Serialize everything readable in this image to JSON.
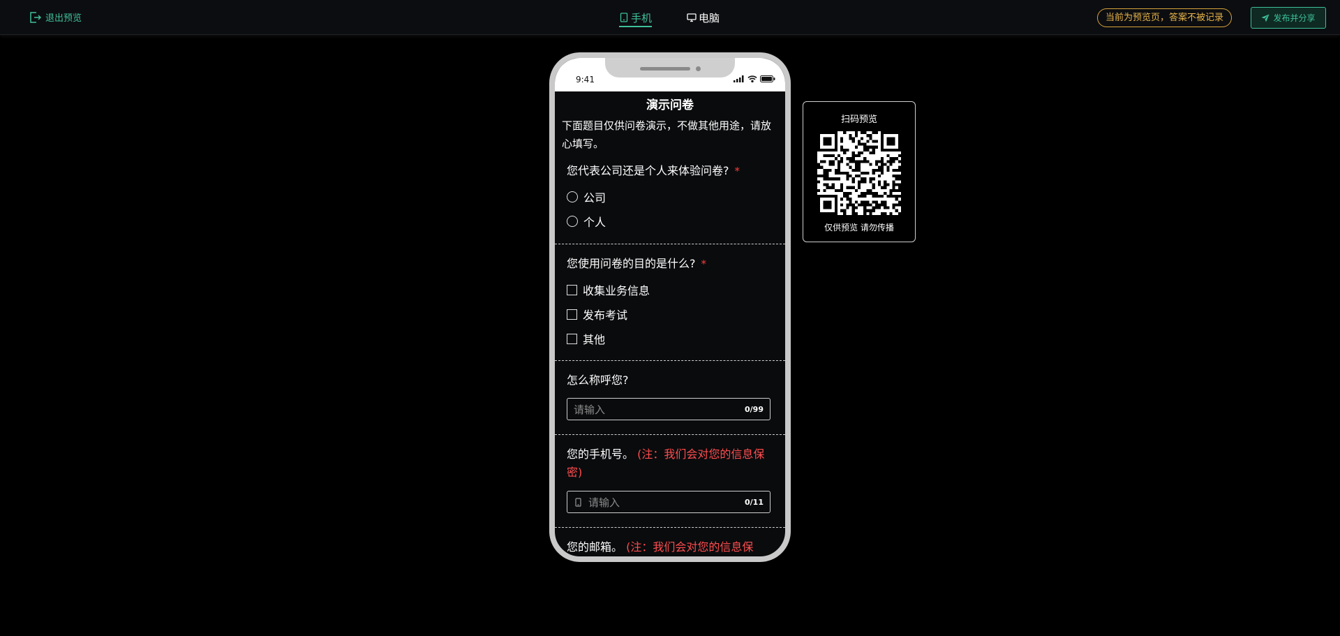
{
  "header": {
    "exit_label": "退出预览",
    "tabs": [
      {
        "label": "手机",
        "active": true,
        "icon": "phone-icon"
      },
      {
        "label": "电脑",
        "active": false,
        "icon": "monitor-icon"
      }
    ],
    "notice": "当前为预览页，答案不被记录",
    "publish_label": "发布并分享"
  },
  "colors": {
    "accent": "#3ec09a",
    "notice": "#e6b34a",
    "required": "#ff3b3b"
  },
  "phone": {
    "time": "9:41",
    "survey": {
      "title": "演示问卷",
      "description": "下面题目仅供问卷演示，不做其他用途，请放心填写。",
      "questions": [
        {
          "title": "您代表公司还是个人来体验问卷?",
          "required": "*",
          "type": "radio",
          "options": [
            "公司",
            "个人"
          ]
        },
        {
          "title": "您使用问卷的目的是什么?",
          "required": "*",
          "type": "checkbox",
          "options": [
            "收集业务信息",
            "发布考试",
            "其他"
          ]
        },
        {
          "title": "怎么称呼您?",
          "type": "input",
          "placeholder": "请输入",
          "counter": "0/99"
        },
        {
          "title": "您的手机号。",
          "note": "(注：我们会对您的信息保密)",
          "type": "input",
          "placeholder": "请输入",
          "counter": "0/11",
          "icon": "mobile-icon"
        },
        {
          "title": "您的邮箱。",
          "note": "(注：我们会对您的信息保",
          "type": "input"
        }
      ]
    }
  },
  "qr": {
    "title": "扫码预览",
    "footer": "仅供预览 请勿传播"
  }
}
